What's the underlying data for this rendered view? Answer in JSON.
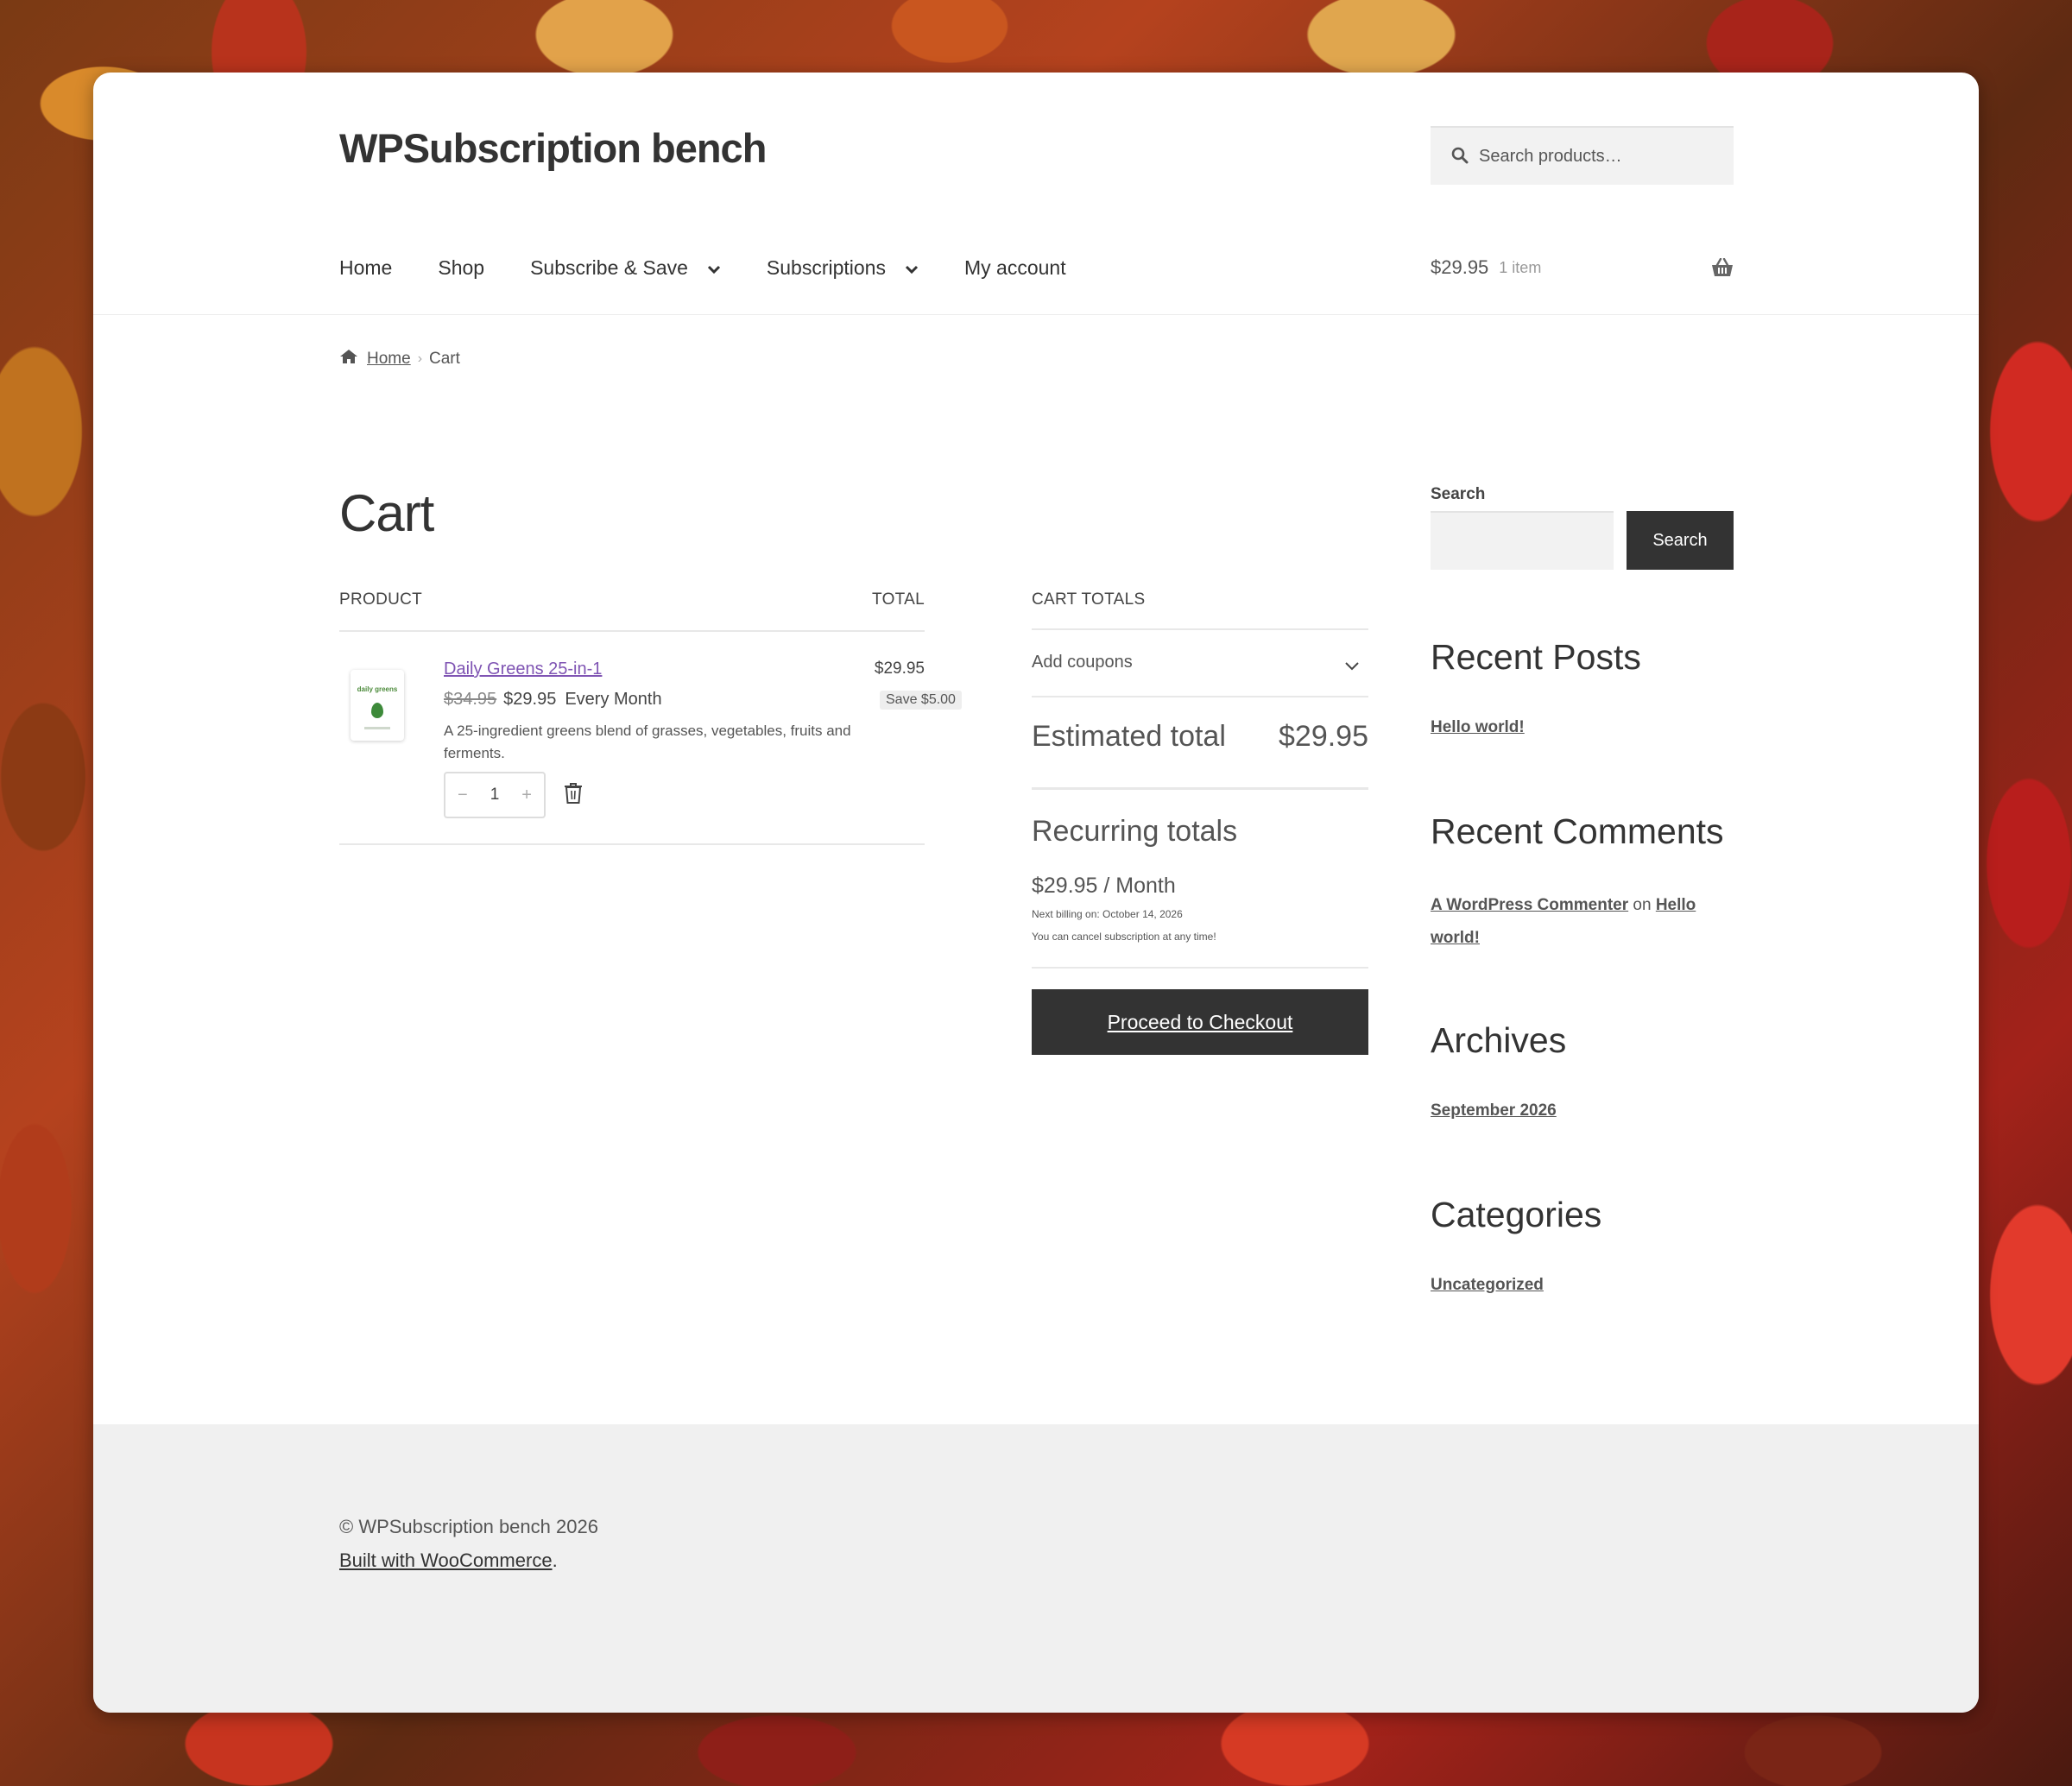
{
  "site": {
    "title": "WPSubscription bench"
  },
  "search": {
    "placeholder": "Search products…"
  },
  "nav": {
    "items": [
      {
        "label": "Home"
      },
      {
        "label": "Shop"
      },
      {
        "label": "Subscribe & Save"
      },
      {
        "label": "Subscriptions"
      },
      {
        "label": "My account"
      }
    ]
  },
  "mini_cart": {
    "amount": "$29.95",
    "count": "1 item"
  },
  "breadcrumb": {
    "home": "Home",
    "current": "Cart"
  },
  "page": {
    "title": "Cart"
  },
  "cart_table": {
    "col_product": "PRODUCT",
    "col_total": "TOTAL",
    "items": [
      {
        "thumb_label": "daily greens",
        "name": "Daily Greens 25-in-1",
        "regular_price": "$34.95",
        "sale_price": "$29.95",
        "period": "Every Month",
        "description": "A 25-ingredient greens blend of grasses, vegetables, fruits and ferments.",
        "quantity": "1",
        "minus": "−",
        "plus": "+",
        "line_total": "$29.95",
        "save_badge": "Save $5.00"
      }
    ]
  },
  "totals": {
    "heading": "CART TOTALS",
    "coupons_label": "Add coupons",
    "estimated_label": "Estimated total",
    "estimated_value": "$29.95",
    "recurring_title": "Recurring totals",
    "recurring_price": "$29.95 / Month",
    "next_billing": "Next billing on: October 14, 2026",
    "cancel_note": "You can cancel subscription at any time!",
    "checkout_label": "Proceed to Checkout"
  },
  "sidebar": {
    "search_label": "Search",
    "search_button": "Search",
    "recent_posts_title": "Recent Posts",
    "recent_posts": [
      "Hello world!"
    ],
    "recent_comments_title": "Recent Comments",
    "comment_author": "A WordPress Commenter",
    "comment_on": "on",
    "comment_post": "Hello world!",
    "archives_title": "Archives",
    "archives": [
      "September 2026"
    ],
    "categories_title": "Categories",
    "categories": [
      "Uncategorized"
    ]
  },
  "footer": {
    "copyright": "© WPSubscription bench 2026",
    "built_with": "Built with WooCommerce",
    "built_suffix": "."
  },
  "colors": {
    "link_purple": "#7f54b3",
    "button_dark": "#333333",
    "footer_bg": "#f0f0f0",
    "search_bg": "#f2f2f2"
  }
}
